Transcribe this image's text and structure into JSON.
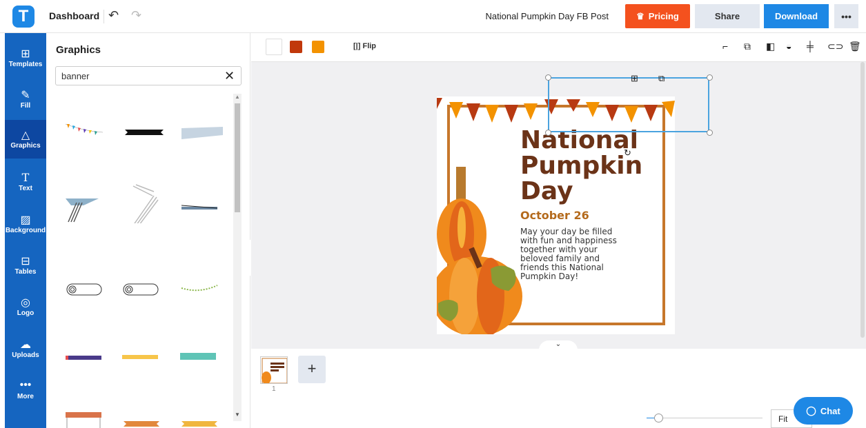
{
  "app": {
    "logo_letter": "T",
    "dashboard_label": "Dashboard",
    "doc_title": "National Pumpkin Day FB Post"
  },
  "topbar": {
    "pricing_label": "Pricing",
    "share_label": "Share",
    "download_label": "Download",
    "more_label": "•••"
  },
  "leftnav": {
    "items": [
      {
        "label": "Templates",
        "icon": "templates-icon"
      },
      {
        "label": "Fill",
        "icon": "brush-icon"
      },
      {
        "label": "Graphics",
        "icon": "shapes-icon",
        "active": true
      },
      {
        "label": "Text",
        "icon": "text-icon"
      },
      {
        "label": "Background",
        "icon": "background-icon"
      },
      {
        "label": "Tables",
        "icon": "table-icon"
      },
      {
        "label": "Logo",
        "icon": "logo-icon"
      },
      {
        "label": "Uploads",
        "icon": "upload-cloud-icon"
      },
      {
        "label": "More",
        "icon": "more-dots-icon"
      }
    ]
  },
  "panel": {
    "title": "Graphics",
    "search_value": "banner"
  },
  "toolbar": {
    "flip_label": "Flip",
    "colors": [
      "#ffffff",
      "#c1380b",
      "#f39200"
    ]
  },
  "design": {
    "title_line1": "National",
    "title_line2": "Pumpkin",
    "title_line3": "Day",
    "date": "October 26",
    "body": "May your day be filled with fun and happiness together with your beloved family and friends this National Pumpkin Day!"
  },
  "pages": {
    "page_number": "1",
    "add_label": "+"
  },
  "zoom": {
    "fit_label": "Fit",
    "level_fraction": 0.1
  },
  "chat": {
    "label": "Chat"
  }
}
